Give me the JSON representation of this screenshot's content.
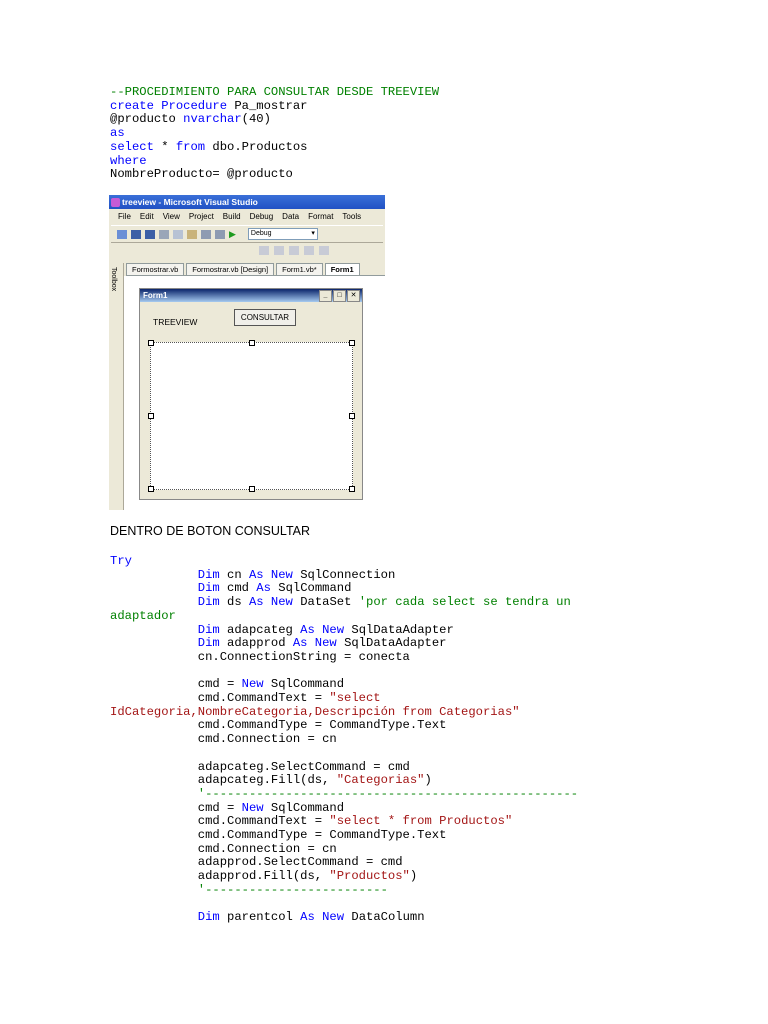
{
  "sql_lines": [
    [
      {
        "t": "--PROCEDIMIENTO PARA CONSULTAR DESDE TREEVIEW",
        "c": "cm"
      }
    ],
    [
      {
        "t": "create Procedure",
        "c": "kw"
      },
      {
        "t": " Pa_mostrar"
      }
    ],
    [
      {
        "t": "@producto "
      },
      {
        "t": "nvarchar",
        "c": "kw"
      },
      {
        "t": "(40)"
      }
    ],
    [
      {
        "t": "as",
        "c": "kw"
      }
    ],
    [
      {
        "t": "select",
        "c": "kw"
      },
      {
        "t": " * "
      },
      {
        "t": "from",
        "c": "kw"
      },
      {
        "t": " dbo.Productos"
      }
    ],
    [
      {
        "t": "where",
        "c": "kw"
      }
    ],
    [
      {
        "t": "NombreProducto= @producto"
      }
    ]
  ],
  "vs": {
    "window_title": "treeview - Microsoft Visual Studio",
    "menu": [
      "File",
      "Edit",
      "View",
      "Project",
      "Build",
      "Debug",
      "Data",
      "Format",
      "Tools"
    ],
    "config_combo": "Debug",
    "tabs": [
      "Formostrar.vb",
      "Formostrar.vb [Design]",
      "Form1.vb*",
      "Form1"
    ],
    "toolbox_label": "Toolbox",
    "form_title": "Form1",
    "label_text": "TREEVIEW",
    "button_text": "CONSULTAR"
  },
  "section_heading": "DENTRO DE BOTON CONSULTAR",
  "vb_lines": [
    [
      {
        "t": "Try",
        "c": "kw"
      }
    ],
    [
      {
        "t": "            "
      },
      {
        "t": "Dim",
        "c": "kw"
      },
      {
        "t": " cn "
      },
      {
        "t": "As New",
        "c": "kw"
      },
      {
        "t": " SqlConnection"
      }
    ],
    [
      {
        "t": "            "
      },
      {
        "t": "Dim",
        "c": "kw"
      },
      {
        "t": " cmd "
      },
      {
        "t": "As",
        "c": "kw"
      },
      {
        "t": " SqlCommand"
      }
    ],
    [
      {
        "t": "            "
      },
      {
        "t": "Dim",
        "c": "kw"
      },
      {
        "t": " ds "
      },
      {
        "t": "As New",
        "c": "kw"
      },
      {
        "t": " DataSet "
      },
      {
        "t": "'por cada select se tendra un",
        "c": "cm"
      }
    ],
    [
      {
        "t": "adaptador",
        "c": "cm"
      }
    ],
    [
      {
        "t": "            "
      },
      {
        "t": "Dim",
        "c": "kw"
      },
      {
        "t": " adapcateg "
      },
      {
        "t": "As New",
        "c": "kw"
      },
      {
        "t": " SqlDataAdapter"
      }
    ],
    [
      {
        "t": "            "
      },
      {
        "t": "Dim",
        "c": "kw"
      },
      {
        "t": " adapprod "
      },
      {
        "t": "As New",
        "c": "kw"
      },
      {
        "t": " SqlDataAdapter"
      }
    ],
    [
      {
        "t": "            cn.ConnectionString = conecta"
      }
    ],
    [
      {
        "t": ""
      }
    ],
    [
      {
        "t": "            cmd = "
      },
      {
        "t": "New",
        "c": "kw"
      },
      {
        "t": " SqlCommand"
      }
    ],
    [
      {
        "t": "            cmd.CommandText = "
      },
      {
        "t": "\"select",
        "c": "st"
      }
    ],
    [
      {
        "t": "IdCategoria,NombreCategoria,Descripción from Categorias\"",
        "c": "st"
      }
    ],
    [
      {
        "t": "            cmd.CommandType = CommandType.Text"
      }
    ],
    [
      {
        "t": "            cmd.Connection = cn"
      }
    ],
    [
      {
        "t": ""
      }
    ],
    [
      {
        "t": "            adapcateg.SelectCommand = cmd"
      }
    ],
    [
      {
        "t": "            adapcateg.Fill(ds, "
      },
      {
        "t": "\"Categorias\"",
        "c": "st"
      },
      {
        "t": ")"
      }
    ],
    [
      {
        "t": "            "
      },
      {
        "t": "'---------------------------------------------------",
        "c": "cm"
      }
    ],
    [
      {
        "t": "            cmd = "
      },
      {
        "t": "New",
        "c": "kw"
      },
      {
        "t": " SqlCommand"
      }
    ],
    [
      {
        "t": "            cmd.CommandText = "
      },
      {
        "t": "\"select * from Productos\"",
        "c": "st"
      }
    ],
    [
      {
        "t": "            cmd.CommandType = CommandType.Text"
      }
    ],
    [
      {
        "t": "            cmd.Connection = cn"
      }
    ],
    [
      {
        "t": "            adapprod.SelectCommand = cmd"
      }
    ],
    [
      {
        "t": "            adapprod.Fill(ds, "
      },
      {
        "t": "\"Productos\"",
        "c": "st"
      },
      {
        "t": ")"
      }
    ],
    [
      {
        "t": "            "
      },
      {
        "t": "'-------------------------",
        "c": "cm"
      }
    ],
    [
      {
        "t": ""
      }
    ],
    [
      {
        "t": "            "
      },
      {
        "t": "Dim",
        "c": "kw"
      },
      {
        "t": " parentcol "
      },
      {
        "t": "As New",
        "c": "kw"
      },
      {
        "t": " DataColumn"
      }
    ]
  ]
}
